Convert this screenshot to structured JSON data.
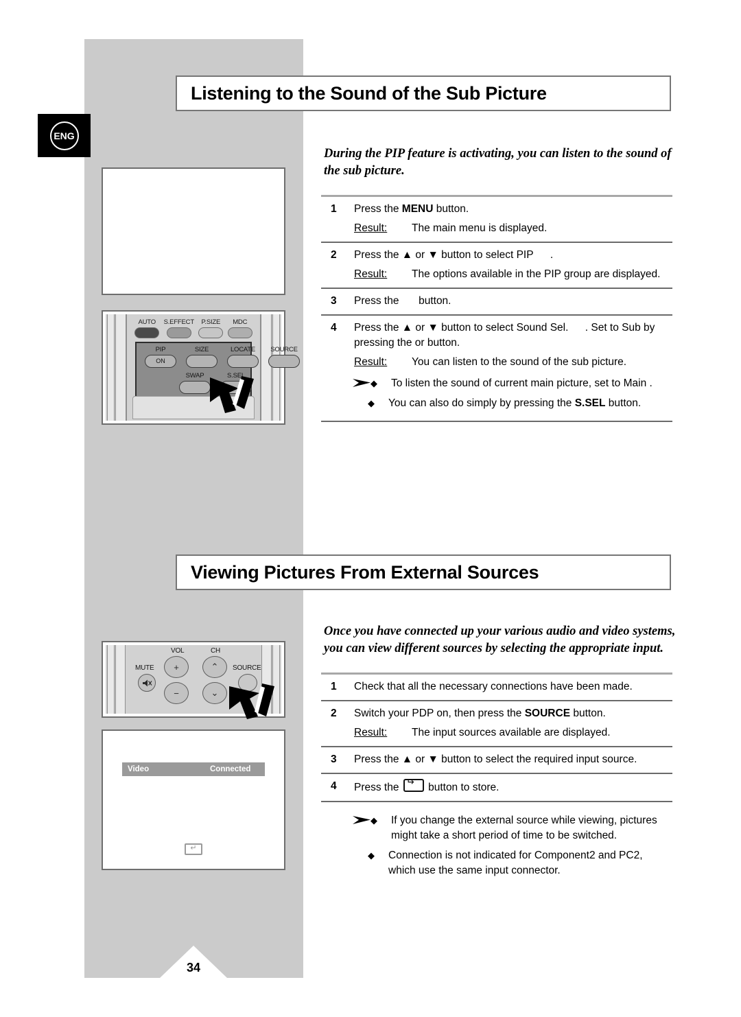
{
  "page": {
    "number": "34",
    "language_badge": "ENG"
  },
  "sections": [
    {
      "heading": "Listening to the Sound of the Sub Picture",
      "intro": "During the PIP feature is activating, you can listen to the sound of the sub picture.",
      "steps": [
        {
          "num": "1",
          "action_pre": "Press the ",
          "action_bold": "MENU",
          "action_post": " button.",
          "result_label": "Result:",
          "result_text": "The main menu is displayed."
        },
        {
          "num": "2",
          "action_pre": "Press the ▲ or ▼ button to select PIP",
          "action_bold": "",
          "action_post": " .",
          "result_label": "Result:",
          "result_text": "The options available in the PIP  group are displayed."
        },
        {
          "num": "3",
          "action_pre": "Press the ",
          "action_bold": "",
          "action_post": " button.",
          "result_label": "",
          "result_text": ""
        },
        {
          "num": "4",
          "action_pre": "Press the ▲ or ▼ button to select Sound Sel.",
          "action_bold": "",
          "action_post": " . Set to Sub by pressing the   or   button.",
          "result_label": "Result:",
          "result_text": "You can listen to the sound of the sub picture."
        }
      ],
      "notes": [
        "To listen the sound of current main picture, set to Main .",
        "You can also do simply by pressing the S.SEL button."
      ],
      "note2_pre": "You can also do simply by pressing the ",
      "note2_bold": "S.SEL",
      "note2_post": " button."
    },
    {
      "heading": "Viewing Pictures From External Sources",
      "intro": "Once you have connected up your various audio and video systems, you can view different sources by selecting the appropriate input.",
      "steps": [
        {
          "num": "1",
          "action_pre": "Check that all the necessary connections have been made.",
          "action_bold": "",
          "action_post": "",
          "result_label": "",
          "result_text": ""
        },
        {
          "num": "2",
          "action_pre": "Switch your PDP on, then press the ",
          "action_bold": "SOURCE",
          "action_post": " button.",
          "result_label": "Result:",
          "result_text": "The input sources available are displayed."
        },
        {
          "num": "3",
          "action_pre": "Press the ▲ or ▼ button to select the required input source.",
          "action_bold": "",
          "action_post": "",
          "result_label": "",
          "result_text": ""
        },
        {
          "num": "4",
          "action_pre": "Press the ",
          "action_bold": "",
          "action_post": " button to store.",
          "result_label": "",
          "result_text": ""
        }
      ],
      "notes": [
        "If you change the external source while viewing, pictures might take a short period of time to be switched.",
        "Connection is not indicated for Component2 and PC2, which use the same input connector."
      ]
    }
  ],
  "illustrations": {
    "remote_pip": {
      "top_buttons": [
        "AUTO",
        "S.EFFECT",
        "P.SIZE",
        "MDC"
      ],
      "panel_row1": [
        "PIP",
        "SIZE",
        "LOCATE",
        "SOURCE"
      ],
      "pip_state": "ON",
      "panel_row2": [
        "SWAP",
        "S.SEL"
      ]
    },
    "remote_vol": {
      "labels": [
        "VOL",
        "CH",
        "MUTE",
        "SOURCE"
      ],
      "vol_plus": "+",
      "vol_minus": "−",
      "ch_up": "⌃",
      "ch_down": "⌄",
      "mute_icon": "mute-icon"
    },
    "osd": {
      "source_name": "Video",
      "status": "Connected",
      "enter_key": "↵"
    }
  },
  "colors": {
    "panel_gray": "#cbcbcb",
    "heading_border": "#767676",
    "rule_gray": "#a8a8a8",
    "osd_bar": "#9a9a9a"
  }
}
